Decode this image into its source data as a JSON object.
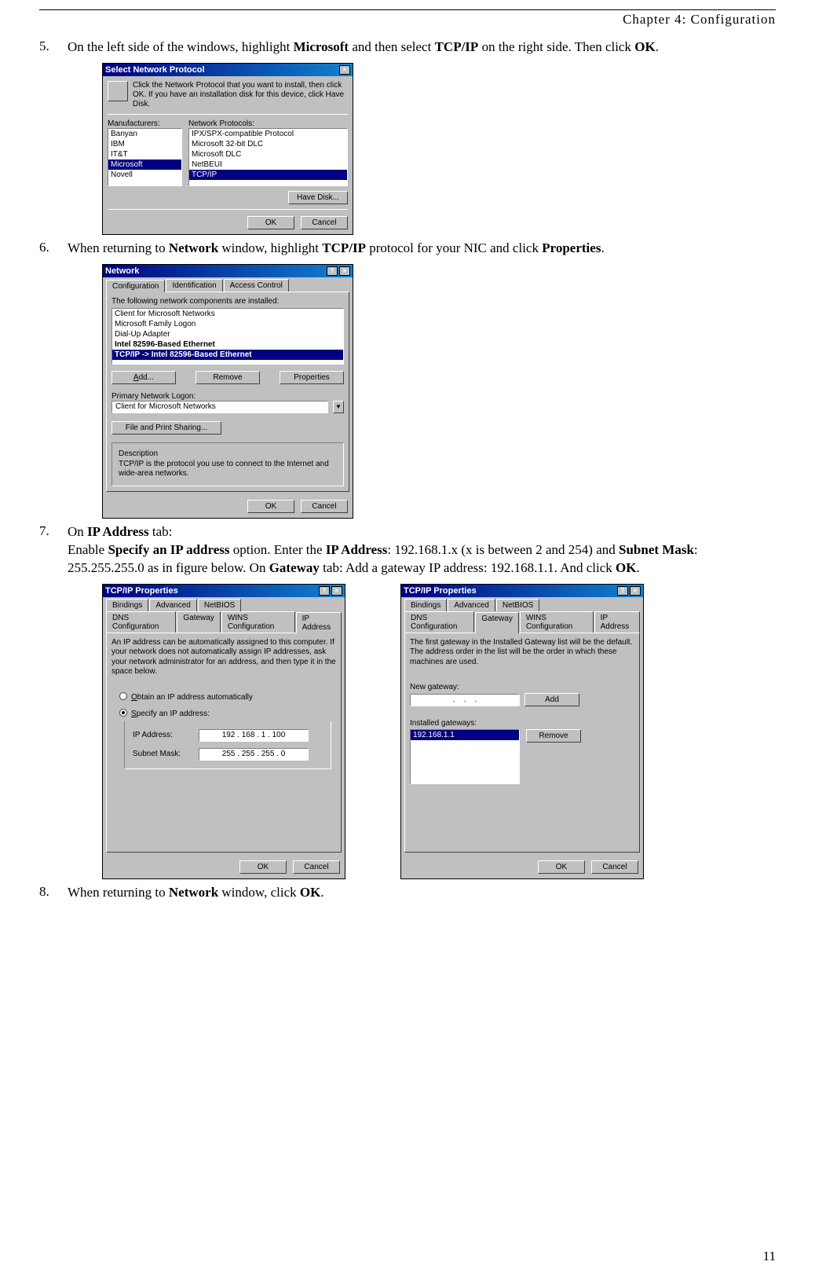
{
  "header": {
    "chapter": "Chapter 4: Configuration"
  },
  "steps": {
    "s5": {
      "num": "5.",
      "text_a": "On the left side of the windows, highlight ",
      "b1": "Microsoft",
      "text_b": " and then select ",
      "b2": "TCP/IP",
      "text_c": " on the right side. Then click ",
      "b3": "OK",
      "text_d": "."
    },
    "s6": {
      "num": "6.",
      "text_a": "When returning to ",
      "b1": "Network",
      "text_b": " window, highlight ",
      "b2": "TCP/IP",
      "text_c": " protocol for your NIC and click ",
      "b3": "Properties",
      "text_d": "."
    },
    "s7": {
      "num": "7.",
      "line1_a": "On ",
      "line1_b": "IP Address",
      "line1_c": " tab:",
      "line2_a": "Enable ",
      "line2_b": "Specify an IP address",
      "line2_c": " option. Enter the ",
      "line2_d": "IP Address",
      "line2_e": ": 192.168.1.x (x is between 2 and 254) and ",
      "line2_f": "Subnet Mask",
      "line2_g": ": 255.255.255.0 as in figure below. On ",
      "line2_h": "Gateway",
      "line2_i": " tab: Add a gateway IP address: 192.168.1.1. And click ",
      "line2_j": "OK",
      "line2_k": "."
    },
    "s8": {
      "num": "8.",
      "text_a": "When returning to ",
      "b1": "Network",
      "text_b": " window, click ",
      "b2": "OK",
      "text_c": "."
    }
  },
  "fig1": {
    "title": "Select Network Protocol",
    "intro": "Click the Network Protocol that you want to install, then click OK. If you have an installation disk for this device, click Have Disk.",
    "col1_label": "Manufacturers:",
    "col2_label": "Network Protocols:",
    "manufacturers": [
      "Banyan",
      "IBM",
      "IT&T",
      "Microsoft",
      "Novell"
    ],
    "mfr_selected_index": 3,
    "protocols": [
      "IPX/SPX-compatible Protocol",
      "Microsoft 32-bit DLC",
      "Microsoft DLC",
      "NetBEUI",
      "TCP/IP"
    ],
    "proto_selected_index": 4,
    "have_disk": "Have Disk...",
    "ok": "OK",
    "cancel": "Cancel"
  },
  "fig2": {
    "title": "Network",
    "tabs": [
      "Configuration",
      "Identification",
      "Access Control"
    ],
    "list_label": "The following network components are installed:",
    "items": [
      "Client for Microsoft Networks",
      "Microsoft Family Logon",
      "Dial-Up Adapter",
      "Intel 82596-Based Ethernet",
      "TCP/IP -> Intel 82596-Based Ethernet"
    ],
    "selected_index": 4,
    "add": "Add...",
    "remove": "Remove",
    "properties": "Properties",
    "primary_label": "Primary Network Logon:",
    "primary_value": "Client for Microsoft Networks",
    "fps": "File and Print Sharing...",
    "desc_label": "Description",
    "desc_text": "TCP/IP is the protocol you use to connect to the Internet and wide-area networks.",
    "ok": "OK",
    "cancel": "Cancel"
  },
  "fig3": {
    "title": "TCP/IP Properties",
    "tabs_top": [
      "Bindings",
      "Advanced",
      "NetBIOS"
    ],
    "tabs_bottom": [
      "DNS Configuration",
      "Gateway",
      "WINS Configuration",
      "IP Address"
    ],
    "active_tab": "IP Address",
    "intro": "An IP address can be automatically assigned to this computer. If your network does not automatically assign IP addresses, ask your network administrator for an address, and then type it in the space below.",
    "radio_auto": "Obtain an IP address automatically",
    "radio_spec": "Specify an IP address:",
    "ip_label": "IP Address:",
    "ip_value": "192 . 168 .  1  . 100",
    "mask_label": "Subnet Mask:",
    "mask_value": "255 . 255 . 255 .  0",
    "ok": "OK",
    "cancel": "Cancel"
  },
  "fig4": {
    "title": "TCP/IP Properties",
    "tabs_top": [
      "Bindings",
      "Advanced",
      "NetBIOS"
    ],
    "tabs_bottom": [
      "DNS Configuration",
      "Gateway",
      "WINS Configuration",
      "IP Address"
    ],
    "active_tab": "Gateway",
    "intro": "The first gateway in the Installed Gateway list will be the default. The address order in the list will be the order in which these machines are used.",
    "new_label": "New gateway:",
    "add": "Add",
    "installed_label": "Installed gateways:",
    "installed_value": "192.168.1.1",
    "remove": "Remove",
    "ok": "OK",
    "cancel": "Cancel"
  },
  "page_number": "11"
}
